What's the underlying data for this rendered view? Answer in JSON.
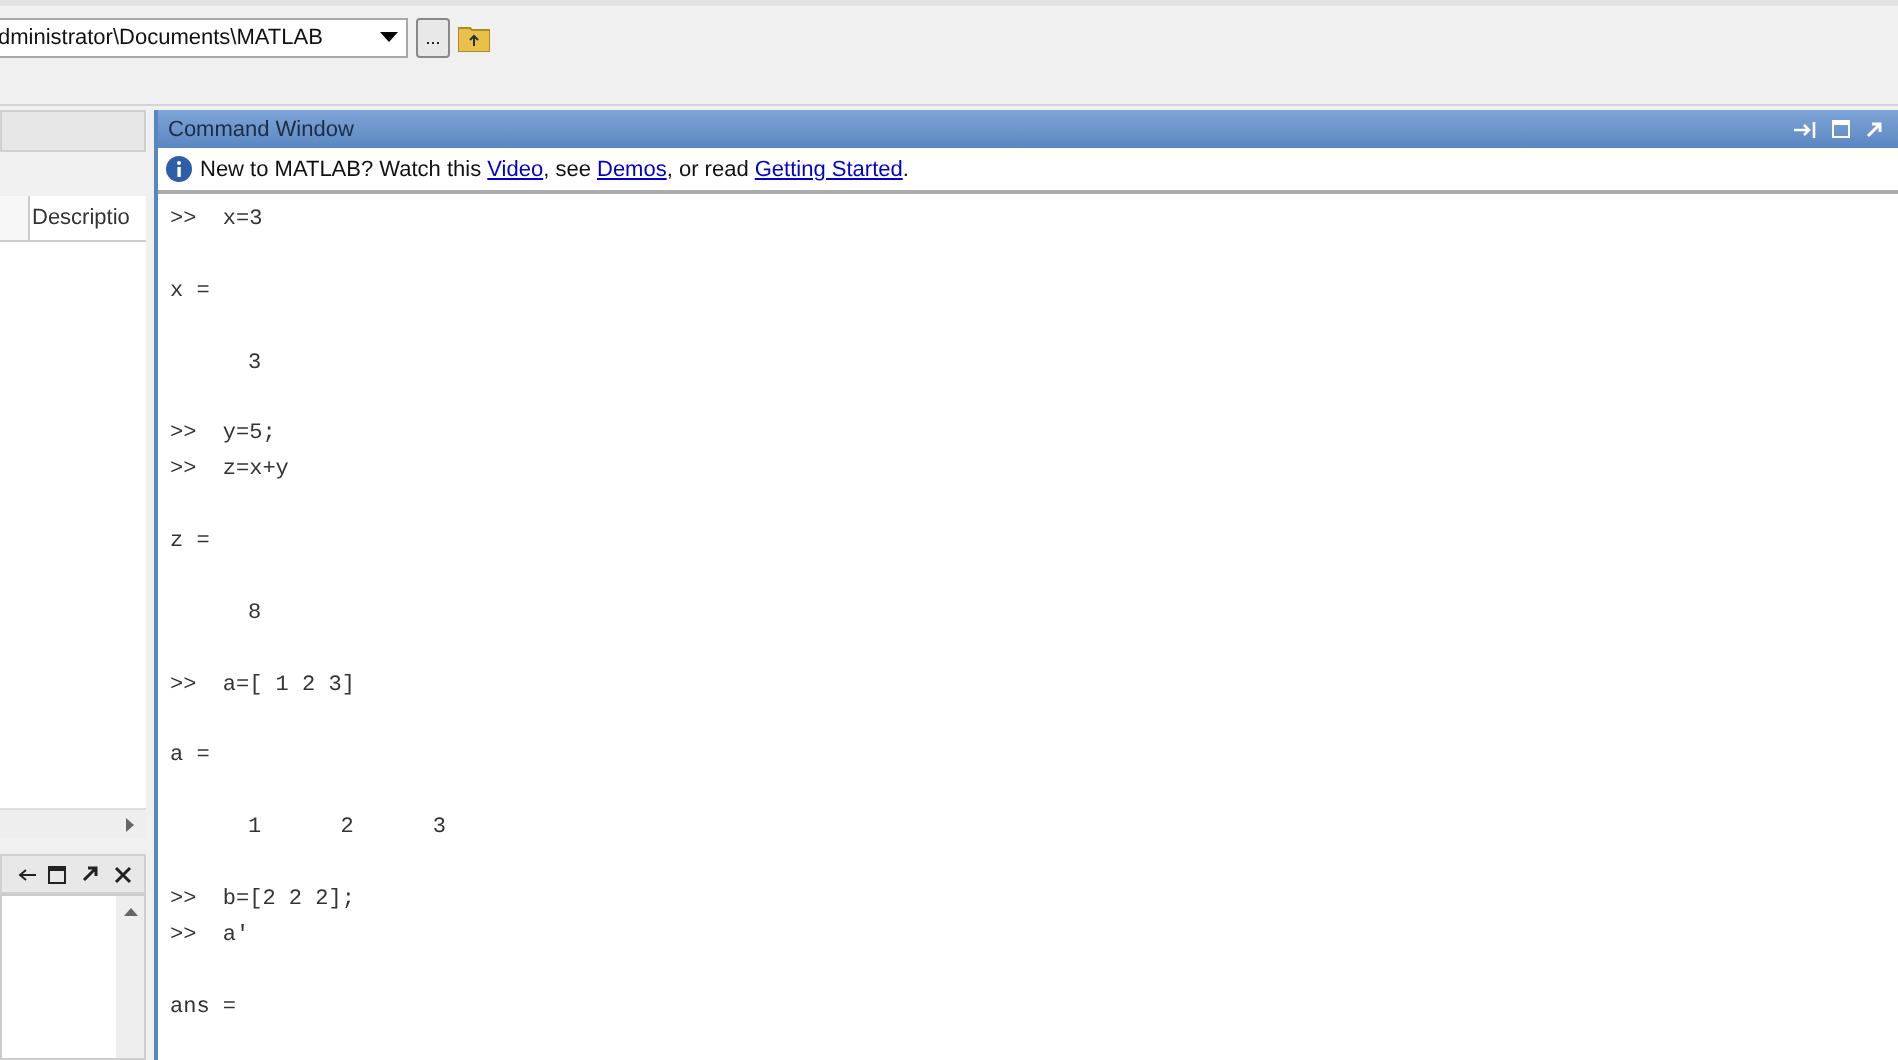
{
  "toolbar": {
    "current_folder": "dministrator\\Documents\\MATLAB",
    "browse_button": "..."
  },
  "left_panel": {
    "column_header": "Descriptio"
  },
  "command_window": {
    "title": "Command Window",
    "info": [
      {
        "kind": "text",
        "text": "New to MATLAB? Watch this "
      },
      {
        "kind": "link",
        "text": "Video"
      },
      {
        "kind": "text",
        "text": ", see "
      },
      {
        "kind": "link",
        "text": "Demos"
      },
      {
        "kind": "text",
        "text": ", or read "
      },
      {
        "kind": "link",
        "text": "Getting Started"
      },
      {
        "kind": "text",
        "text": "."
      }
    ],
    "lines": [
      {
        "kind": "input",
        "text": ">>  x=3"
      },
      {
        "kind": "blank"
      },
      {
        "kind": "output",
        "text": "x ="
      },
      {
        "kind": "blank"
      },
      {
        "kind": "value",
        "text": "3"
      },
      {
        "kind": "blank"
      },
      {
        "kind": "input",
        "text": ">>  y=5;"
      },
      {
        "kind": "input",
        "text": ">>  z=x+y"
      },
      {
        "kind": "blank"
      },
      {
        "kind": "output",
        "text": "z ="
      },
      {
        "kind": "blank"
      },
      {
        "kind": "value",
        "text": "8"
      },
      {
        "kind": "blank"
      },
      {
        "kind": "input",
        "text": ">>  a=[ 1 2 3]"
      },
      {
        "kind": "blank"
      },
      {
        "kind": "output",
        "text": "a ="
      },
      {
        "kind": "blank"
      },
      {
        "kind": "value",
        "text": "1      2      3"
      },
      {
        "kind": "blank"
      },
      {
        "kind": "input",
        "text": ">>  b=[2 2 2];"
      },
      {
        "kind": "input",
        "text": ">>  a'"
      },
      {
        "kind": "blank"
      },
      {
        "kind": "output",
        "text": "ans ="
      }
    ]
  }
}
